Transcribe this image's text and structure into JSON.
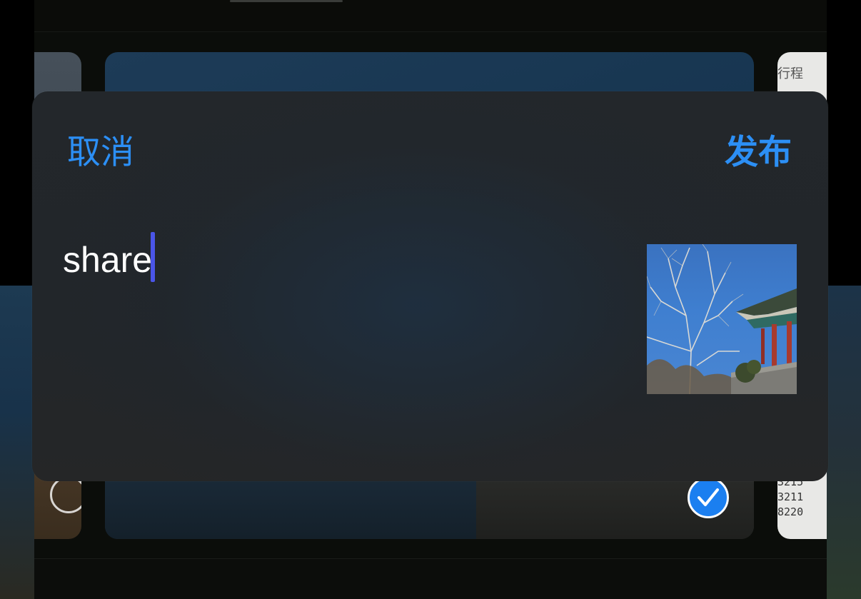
{
  "modal": {
    "cancel_label": "取消",
    "publish_label": "发布",
    "text_value": "share",
    "accent_color": "#2c8ff5",
    "caret_color": "#4a55e8"
  },
  "background": {
    "right_thumb_title": "行程",
    "right_thumb_numbers": "3215\n3211\n8220"
  },
  "icons": {
    "selected_check": "checkmark-icon",
    "unselected_radio": "radio-circle-icon"
  }
}
